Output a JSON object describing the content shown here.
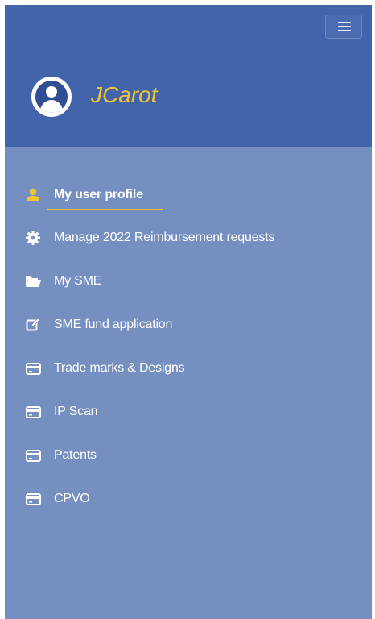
{
  "header": {
    "username": "JCarot",
    "menu_toggle_icon": "hamburger-icon",
    "avatar_icon": "user-circle-icon"
  },
  "colors": {
    "header_bg": "#4264aa",
    "panel_bg": "#7590c0",
    "accent": "#f3c431",
    "text": "#ffffff"
  },
  "nav": {
    "items": [
      {
        "label": "My user profile",
        "icon": "user-icon",
        "active": true
      },
      {
        "label": "Manage 2022 Reimbursement requests",
        "icon": "gear-icon",
        "active": false
      },
      {
        "label": "My SME",
        "icon": "folder-open-icon",
        "active": false
      },
      {
        "label": "SME fund application",
        "icon": "edit-icon",
        "active": false
      },
      {
        "label": "Trade marks & Designs",
        "icon": "credit-card-icon",
        "active": false
      },
      {
        "label": "IP Scan",
        "icon": "credit-card-icon",
        "active": false
      },
      {
        "label": "Patents",
        "icon": "credit-card-icon",
        "active": false
      },
      {
        "label": "CPVO",
        "icon": "credit-card-icon",
        "active": false
      }
    ]
  }
}
